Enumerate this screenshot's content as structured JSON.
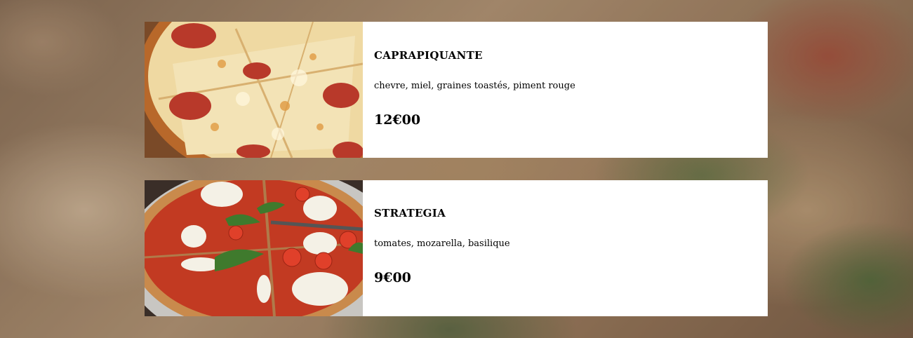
{
  "menu": {
    "items": [
      {
        "name": "CAPRAPIQUANTE",
        "description": "chevre, miel, graines toastés, piment rouge",
        "price": "12€00",
        "image_icon": "pizza-pepperoni-photo"
      },
      {
        "name": "STRATEGIA",
        "description": "tomates, mozarella, basilique",
        "price": "9€00",
        "image_icon": "pizza-margherita-photo"
      }
    ]
  },
  "colors": {
    "card_background": "#ffffff",
    "text": "#000000",
    "tomato_red": "#c2391f",
    "cheese": "#f1e2b8",
    "basil": "#3f7a2d"
  }
}
